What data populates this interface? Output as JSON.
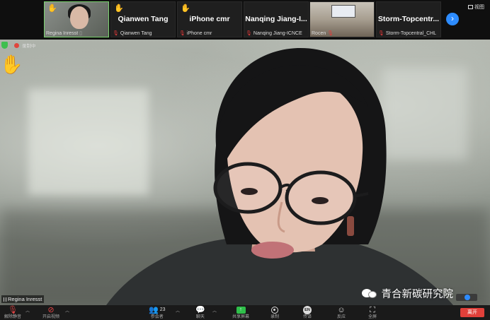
{
  "gallery": {
    "tiles": [
      {
        "name": "Regina Inresst",
        "has_video": true
      },
      {
        "display_name": "Qianwen Tang",
        "name": "Qianwen Tang",
        "has_video": false
      },
      {
        "display_name": "iPhone cmr",
        "name": "iPhone cmr",
        "has_video": false
      },
      {
        "display_name": "Nanqing  Jiang-I...",
        "name": "Nanqing Jiang-ICNCE",
        "has_video": false
      },
      {
        "name": "Rocen",
        "has_video": true
      },
      {
        "display_name": "Storm-Topcentr...",
        "name": "Storm-Topcentral_CHL",
        "has_video": false
      }
    ],
    "next_glyph": "›",
    "view_label": "视图"
  },
  "main_video": {
    "recording_text": "录制中",
    "speaker_label": "Regina Inresst"
  },
  "watermark": {
    "text": "青合新碳研究院"
  },
  "toolbar": {
    "items": [
      {
        "id": "mute",
        "label": "解除静音"
      },
      {
        "id": "video",
        "label": "开启视频"
      },
      {
        "id": "participants",
        "label": "参会者",
        "count": "23"
      },
      {
        "id": "chat",
        "label": "聊天"
      },
      {
        "id": "share",
        "label": "共享屏幕"
      },
      {
        "id": "record",
        "label": "录制"
      },
      {
        "id": "interpretation",
        "label": "传译",
        "badge": "EN"
      },
      {
        "id": "reactions",
        "label": "反应"
      },
      {
        "id": "fullscreen",
        "label": "全屏"
      }
    ],
    "leave_label": "离开"
  },
  "colors": {
    "raise_hand": "#f6c51e",
    "share_green": "#2fbf4a",
    "leave_red": "#e0403a",
    "accent_blue": "#2d8cff"
  }
}
